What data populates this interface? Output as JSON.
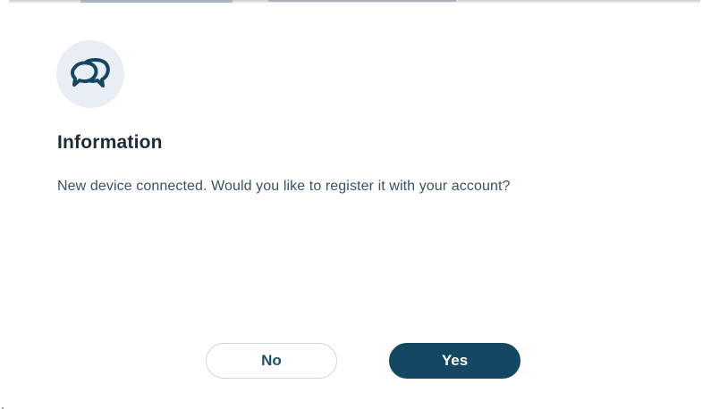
{
  "dialog": {
    "icon": "chat-bubbles-icon",
    "title": "Information",
    "message": "New device connected. Would you like to register it with your account?",
    "buttons": {
      "no_label": "No",
      "yes_label": "Yes"
    }
  },
  "colors": {
    "primary": "#134763",
    "icon_background": "#e8eef3",
    "title_text": "#1e2a36",
    "message_text": "#3a5166",
    "secondary_border": "#cfd6dd"
  }
}
